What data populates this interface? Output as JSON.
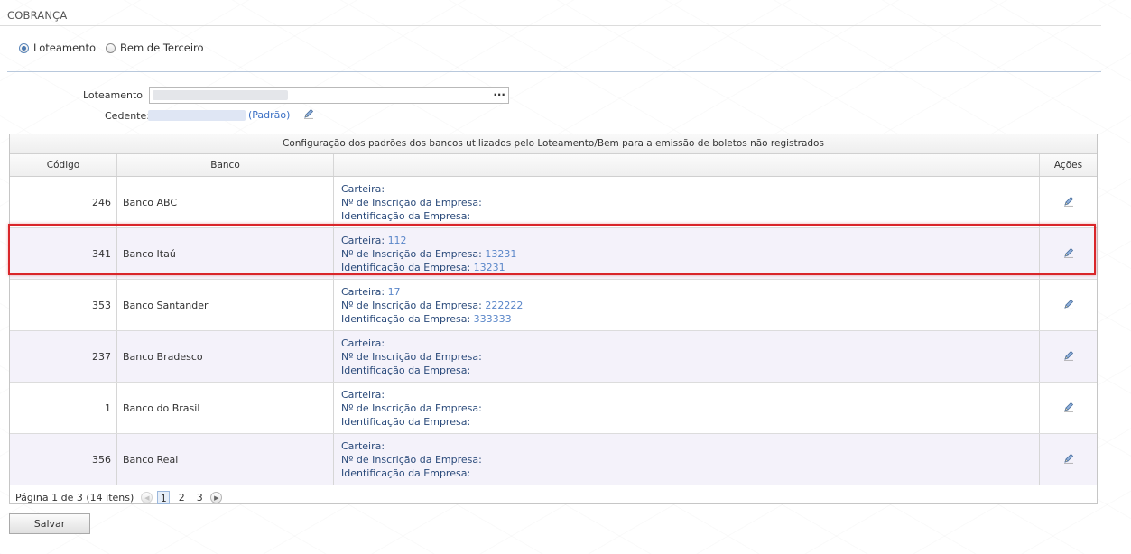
{
  "section_title": "COBRANÇA",
  "radios": [
    {
      "label": "Loteamento",
      "checked": true
    },
    {
      "label": "Bem de Terceiro",
      "checked": false
    }
  ],
  "form": {
    "loteamento_label": "Loteamento",
    "loteamento_button": "···",
    "cedente_label": "Cedente:",
    "cedente_padrao": "(Padrão)"
  },
  "grid": {
    "caption": "Configuração dos padrões dos bancos utilizados pelo Loteamento/Bem para a emissão de boletos não registrados",
    "headers": {
      "codigo": "Código",
      "banco": "Banco",
      "acoes": "Ações"
    },
    "field_labels": {
      "carteira": "Carteira:",
      "inscricao": "Nº de Inscrição da Empresa:",
      "identificacao": "Identificação da Empresa:"
    },
    "rows": [
      {
        "codigo": "246",
        "banco": "Banco ABC",
        "carteira": "",
        "inscricao": "",
        "identificacao": ""
      },
      {
        "codigo": "341",
        "banco": "Banco Itaú",
        "carteira": "112",
        "inscricao": "13231",
        "identificacao": "13231"
      },
      {
        "codigo": "353",
        "banco": "Banco Santander",
        "carteira": "17",
        "inscricao": "222222",
        "identificacao": "333333"
      },
      {
        "codigo": "237",
        "banco": "Banco Bradesco",
        "carteira": "",
        "inscricao": "",
        "identificacao": ""
      },
      {
        "codigo": "1",
        "banco": "Banco do Brasil",
        "carteira": "",
        "inscricao": "",
        "identificacao": ""
      },
      {
        "codigo": "356",
        "banco": "Banco Real",
        "carteira": "",
        "inscricao": "",
        "identificacao": ""
      }
    ],
    "pager": {
      "summary": "Página 1 de 3 (14 itens)",
      "pages": [
        "1",
        "2",
        "3"
      ],
      "current": "1"
    }
  },
  "save_label": "Salvar",
  "colors": {
    "link": "#3a6fc4",
    "highlight": "#d9262a",
    "alt_row": "#f4f2fa"
  }
}
